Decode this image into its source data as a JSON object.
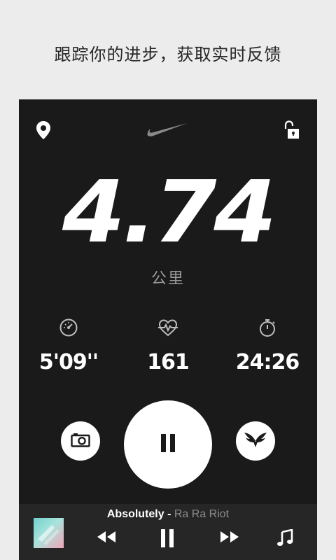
{
  "caption": "跟踪你的进步，获取实时反馈",
  "run": {
    "distance": "4.74",
    "unit": "公里",
    "pace": "5'09''",
    "heart_rate": "161",
    "duration": "24:26"
  },
  "player": {
    "title": "Absolutely",
    "separator": " - ",
    "artist": "Ra Ra Riot"
  },
  "icons": {
    "top_left": "location-pin-icon",
    "top_center": "nike-swoosh-logo",
    "top_right": "unlocked-padlock-icon",
    "pace": "speedometer-icon",
    "heart_rate": "heart-pulse-icon",
    "duration": "stopwatch-icon",
    "camera": "camera-icon",
    "pause": "pause-icon",
    "cheer": "winged-cheer-icon",
    "prev": "rewind-icon",
    "play_pause": "pause-icon",
    "next": "fast-forward-icon",
    "music": "music-note-icon"
  },
  "colors": {
    "background": "#ececec",
    "panel": "#1a1a1a",
    "player_bar": "#262626",
    "text_primary": "#ffffff",
    "text_secondary": "#9a9a9a"
  }
}
